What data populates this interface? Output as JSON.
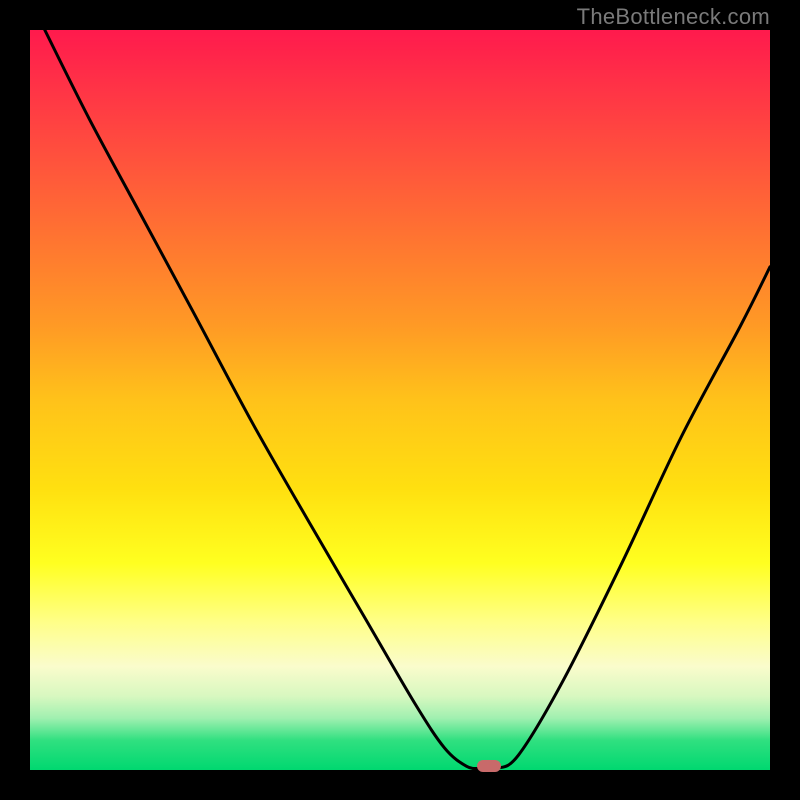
{
  "watermark": "TheBottleneck.com",
  "colors": {
    "frame": "#000000",
    "curve_stroke": "#000000",
    "marker": "#c86a6a"
  },
  "chart_data": {
    "type": "line",
    "title": "",
    "xlabel": "",
    "ylabel": "",
    "xlim": [
      0,
      100
    ],
    "ylim": [
      0,
      100
    ],
    "grid": false,
    "note": "Axes are unlabeled normalized 0–100. y=0 at bottom (green), y=100 at top (red). Curve depicts a bottleneck/mismatch % (high=red=bad) that dips to ~0 at x≈62 then rises again. Values estimated from pixels.",
    "series": [
      {
        "name": "bottleneck-curve",
        "x": [
          2,
          8,
          15,
          22,
          30,
          38,
          45,
          52,
          56,
          59,
          61,
          63,
          66,
          72,
          80,
          88,
          96,
          100
        ],
        "y": [
          100,
          88,
          75,
          62,
          47,
          33,
          21,
          9,
          3,
          0.5,
          0.2,
          0.2,
          2,
          12,
          28,
          45,
          60,
          68
        ]
      }
    ],
    "marker": {
      "x": 62,
      "y": 0.5
    },
    "background_gradient": {
      "top": "#ff1a4d",
      "mid": "#ffe010",
      "bottom": "#00d870"
    }
  }
}
